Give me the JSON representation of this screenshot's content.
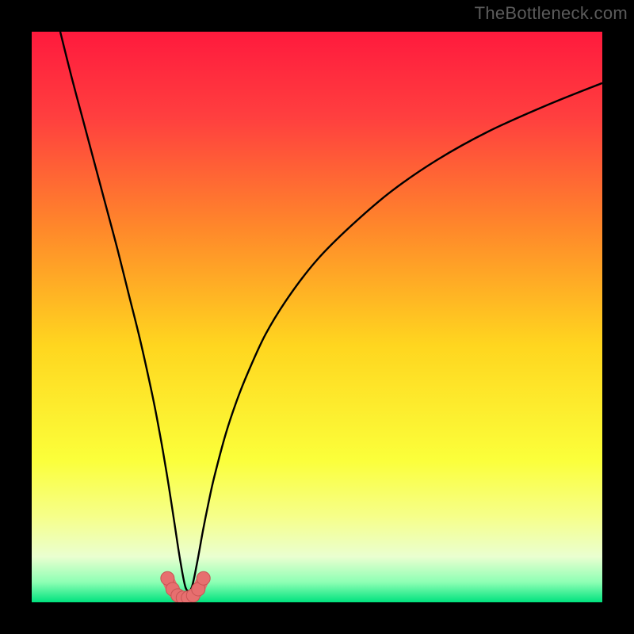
{
  "watermark": "TheBottleneck.com",
  "colors": {
    "frame": "#000000",
    "curve": "#000000",
    "marker_fill": "#e76f6f",
    "marker_stroke": "#c85454",
    "gradient_stops": [
      {
        "offset": 0.0,
        "color": "#ff1a3d"
      },
      {
        "offset": 0.15,
        "color": "#ff3f3f"
      },
      {
        "offset": 0.35,
        "color": "#ff8a2a"
      },
      {
        "offset": 0.55,
        "color": "#ffd61f"
      },
      {
        "offset": 0.75,
        "color": "#fbff3a"
      },
      {
        "offset": 0.85,
        "color": "#f6ff8a"
      },
      {
        "offset": 0.92,
        "color": "#eaffd0"
      },
      {
        "offset": 0.965,
        "color": "#8dffb4"
      },
      {
        "offset": 1.0,
        "color": "#00e27e"
      }
    ]
  },
  "chart_data": {
    "type": "line",
    "title": "",
    "xlabel": "",
    "ylabel": "",
    "xlim": [
      0,
      100
    ],
    "ylim": [
      0,
      100
    ],
    "notch_x": 27,
    "series": [
      {
        "name": "curve",
        "x": [
          5,
          7,
          9,
          11,
          13,
          15,
          17,
          19,
          21,
          22,
          23,
          24,
          25,
          26,
          27,
          28,
          29,
          30,
          31,
          32,
          34,
          36,
          38,
          41,
          45,
          50,
          56,
          63,
          71,
          80,
          90,
          100
        ],
        "y": [
          100,
          92,
          84.5,
          77,
          69.5,
          62,
          54,
          46,
          37,
          32,
          26.5,
          20.5,
          14,
          7.5,
          2.5,
          2.5,
          7,
          12.5,
          17.5,
          22,
          29.5,
          35.5,
          40.5,
          47,
          53.5,
          60,
          66,
          72,
          77.5,
          82.5,
          87,
          91
        ]
      }
    ],
    "markers": {
      "name": "bottom-points",
      "x": [
        23.8,
        24.7,
        25.6,
        26.5,
        27.4,
        28.3,
        29.2,
        30.1
      ],
      "y": [
        4.2,
        2.3,
        1.2,
        0.8,
        0.8,
        1.2,
        2.3,
        4.2
      ]
    }
  }
}
